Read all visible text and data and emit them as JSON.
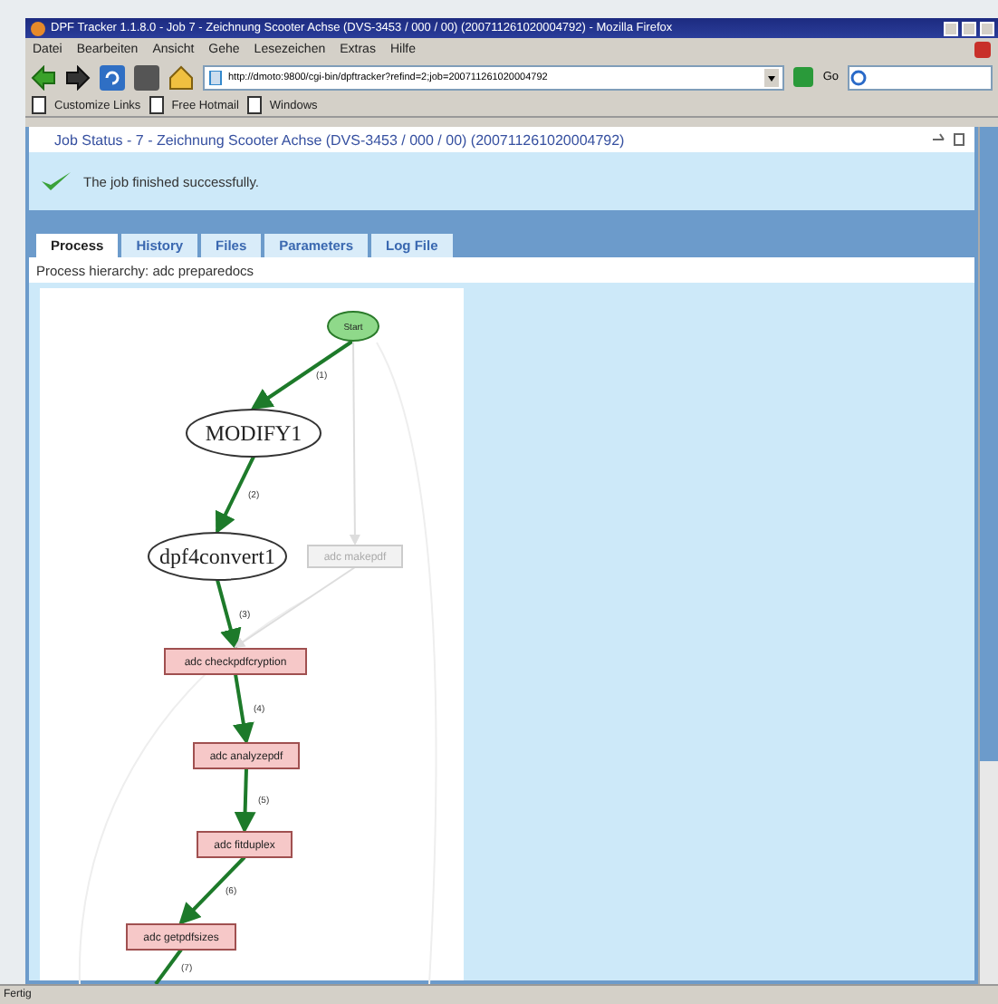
{
  "window": {
    "title": "DPF Tracker 1.1.8.0 - Job 7 - Zeichnung Scooter Achse (DVS-3453 / 000 / 00) (20071126102000479​2) - Mozilla Firefox"
  },
  "menu": [
    "Datei",
    "Bearbeiten",
    "Ansicht",
    "Gehe",
    "Lesezeichen",
    "Extras",
    "Hilfe"
  ],
  "address": {
    "value": "http://dmoto:9800/cgi-bin/dpftracker?refind=2;job=20071126102000479​2"
  },
  "go_label": "Go",
  "bookmarks": [
    "Customize Links",
    "Free Hotmail",
    "Windows"
  ],
  "panel": {
    "title": "Job Status - 7 - Zeichnung Scooter Achse (DVS-3453 / 000 / 00) (20071126102000479​2)",
    "message": "The job finished successfully.",
    "tabs": [
      {
        "label": "Process",
        "selected": true
      },
      {
        "label": "History",
        "selected": false
      },
      {
        "label": "Files",
        "selected": false
      },
      {
        "label": "Parameters",
        "selected": false
      },
      {
        "label": "Log File",
        "selected": false
      }
    ],
    "hierarchy": "Process hierarchy: adc preparedocs",
    "graph": {
      "nodes": [
        {
          "label": "Start",
          "kind": "ellipse",
          "color": "#8fd98a"
        },
        {
          "label": "MODIFY1",
          "kind": "ellipse",
          "color": "#ffffff"
        },
        {
          "label": "dpf4convert1",
          "kind": "ellipse",
          "color": "#ffffff"
        },
        {
          "label": "adc makepdf",
          "kind": "skipped",
          "color": "#f2f2f2"
        },
        {
          "label": "adc checkpdfcryption",
          "kind": "box",
          "color": "#f6c8c8"
        },
        {
          "label": "adc analyzepdf",
          "kind": "box",
          "color": "#f6c8c8"
        },
        {
          "label": "adc fitduplex",
          "kind": "box",
          "color": "#f6c8c8"
        },
        {
          "label": "adc getpdfsizes",
          "kind": "box",
          "color": "#f6c8c8"
        }
      ],
      "edges": [
        {
          "label": "(1)",
          "active": true
        },
        {
          "label": "(2)",
          "active": true
        },
        {
          "label": "(3)",
          "active": true
        },
        {
          "label": "(4)",
          "active": true
        },
        {
          "label": "(5)",
          "active": true
        },
        {
          "label": "(6)",
          "active": true
        },
        {
          "label": "(7)",
          "active": true
        },
        {
          "active": false
        },
        {
          "active": false
        }
      ]
    }
  },
  "status_bar": "Fertig"
}
